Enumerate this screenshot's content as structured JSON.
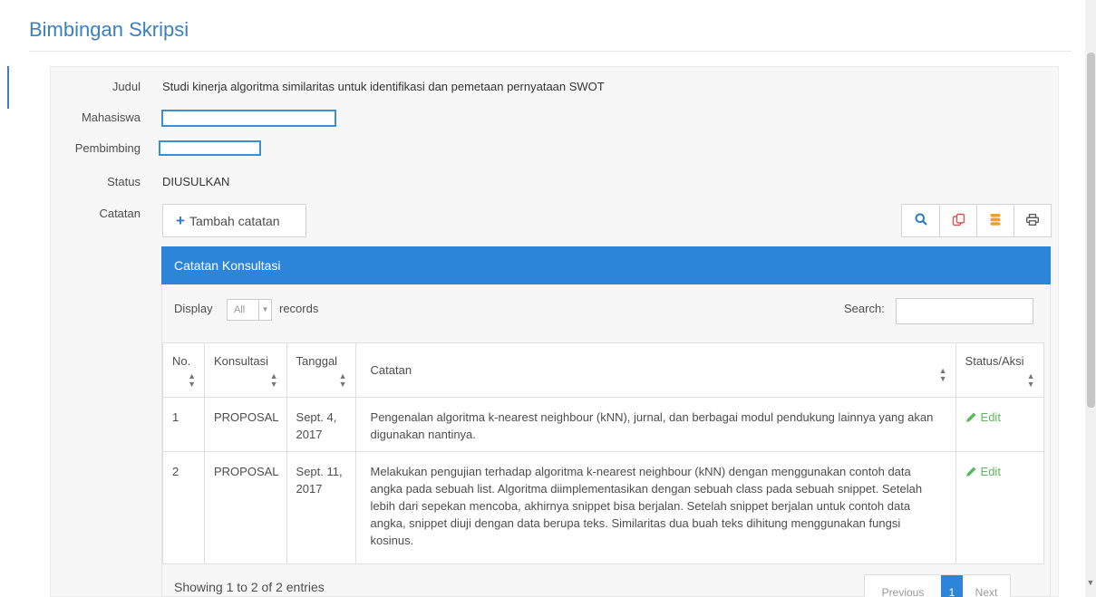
{
  "page": {
    "title": "Bimbingan Skripsi"
  },
  "fields": {
    "judul_label": "Judul",
    "judul_value": "Studi kinerja algoritma similaritas untuk identifikasi dan pemetaan pernyataan SWOT",
    "mahasiswa_label": "Mahasiswa",
    "pembimbing_label": "Pembimbing",
    "status_label": "Status",
    "status_value": "DIUSULKAN",
    "catatan_label": "Catatan"
  },
  "toolbar": {
    "add_label": "Tambah catatan",
    "icons": [
      "search-icon",
      "copy-icon",
      "database-icon",
      "print-icon"
    ]
  },
  "table_box": {
    "header": "Catatan Konsultasi",
    "display_label": "Display",
    "display_value": "All",
    "records_label": "records",
    "search_label": "Search:",
    "columns": [
      "No.",
      "Konsultasi",
      "Tanggal",
      "Catatan",
      "Status/Aksi"
    ],
    "rows": [
      {
        "no": "1",
        "konsultasi": "PROPOSAL",
        "tanggal": "Sept. 4, 2017",
        "catatan": "Pengenalan algoritma k-nearest neighbour (kNN), jurnal, dan berbagai modul pendukung lainnya yang akan digunakan nantinya.",
        "aksi": "Edit"
      },
      {
        "no": "2",
        "konsultasi": "PROPOSAL",
        "tanggal": "Sept. 11, 2017",
        "catatan": "Melakukan pengujian terhadap algoritma k-nearest neighbour (kNN) dengan menggunakan contoh data angka pada sebuah list. Algoritma diimplementasikan dengan sebuah class pada sebuah snippet. Setelah lebih dari sepekan mencoba, akhirnya snippet bisa berjalan. Setelah snippet berjalan untuk contoh data angka, snippet diuji dengan data berupa teks. Similaritas dua buah teks dihitung menggunakan fungsi kosinus.",
        "aksi": "Edit"
      }
    ],
    "info": "Showing 1 to 2 of 2 entries",
    "pagination": {
      "previous": "Previous",
      "current": "1",
      "next": "Next"
    }
  },
  "colors": {
    "accent": "#2c85d8",
    "title": "#3a7fc1",
    "edit": "#5cb85c"
  }
}
